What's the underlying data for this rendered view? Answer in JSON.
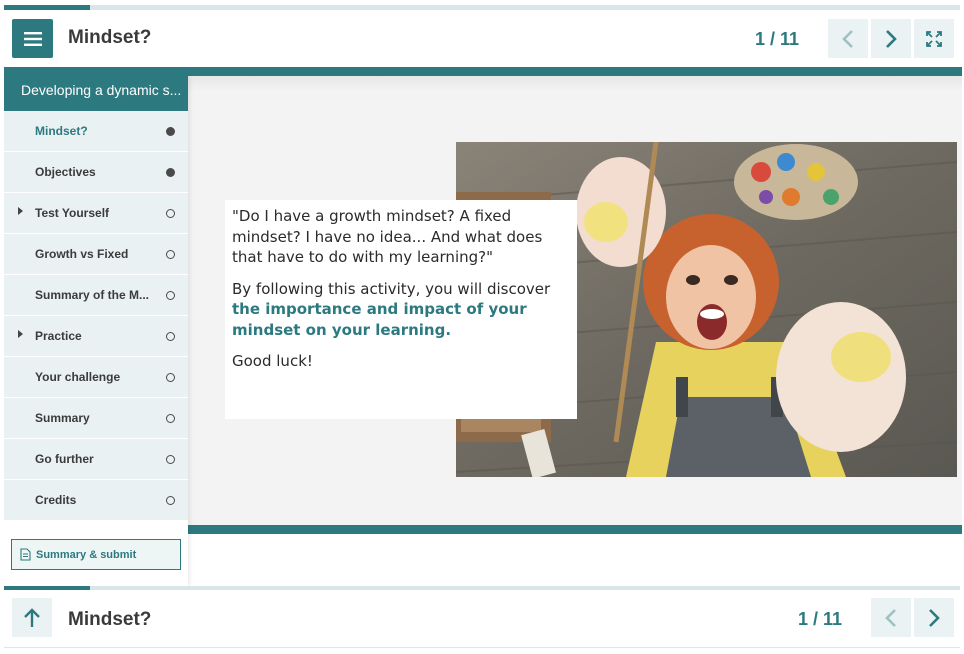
{
  "progress": {
    "fraction": 0.09
  },
  "header": {
    "title": "Mindset?",
    "page_count": "1 / 11"
  },
  "sidebar": {
    "module_title": "Developing a dynamic s...",
    "items": [
      {
        "label": "Mindset?",
        "status": "done",
        "active": true,
        "expandable": false
      },
      {
        "label": "Objectives",
        "status": "done",
        "active": false,
        "expandable": false
      },
      {
        "label": "Test Yourself",
        "status": "todo",
        "active": false,
        "expandable": true
      },
      {
        "label": "Growth vs Fixed",
        "status": "todo",
        "active": false,
        "expandable": false
      },
      {
        "label": "Summary of the M...",
        "status": "todo",
        "active": false,
        "expandable": false
      },
      {
        "label": "Practice",
        "status": "todo",
        "active": false,
        "expandable": true
      },
      {
        "label": "Your challenge",
        "status": "todo",
        "active": false,
        "expandable": false
      },
      {
        "label": "Summary",
        "status": "todo",
        "active": false,
        "expandable": false
      },
      {
        "label": "Go further",
        "status": "todo",
        "active": false,
        "expandable": false
      },
      {
        "label": "Credits",
        "status": "todo",
        "active": false,
        "expandable": false
      }
    ],
    "submit_label": "Summary & submit"
  },
  "content": {
    "quote": "\"Do I have a growth mindset? A fixed mindset? I have no idea... And what does that have to do with my learning?\"",
    "intro_text": "By following this activity, you will discover ",
    "highlight_text": "the importance and impact of your mindset on your learning.",
    "closing": "Good luck!"
  },
  "footer": {
    "title": "Mindset?",
    "page_count": "1 / 11"
  },
  "colors": {
    "accent": "#2c7a80",
    "sidebar_bg": "#eaf1f2",
    "content_bg": "#f3f3f3"
  }
}
